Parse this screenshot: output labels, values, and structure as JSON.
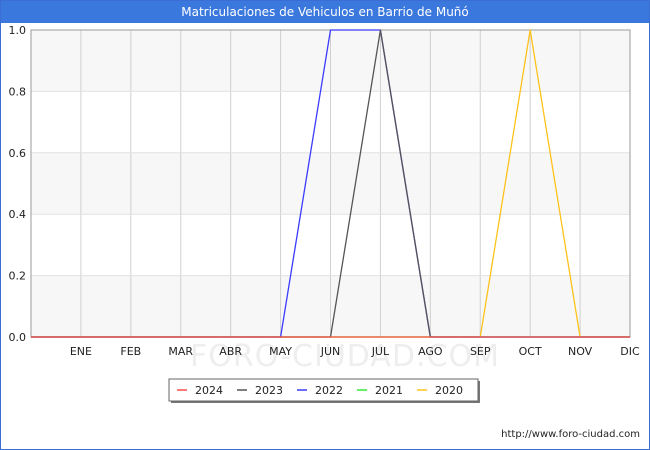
{
  "title": "Matriculaciones de Vehiculos en Barrio de Muñó",
  "watermark": "FORO-CIUDAD.COM",
  "footer_url": "http://www.foro-ciudad.com",
  "chart_data": {
    "type": "line",
    "title": "Matriculaciones de Vehiculos en Barrio de Muñó",
    "xlabel": "",
    "ylabel": "",
    "categories": [
      "",
      "ENE",
      "FEB",
      "MAR",
      "ABR",
      "MAY",
      "JUN",
      "JUL",
      "AGO",
      "SEP",
      "OCT",
      "NOV",
      "DIC"
    ],
    "ylim": [
      0,
      1
    ],
    "yticks": [
      "0.0",
      "0.2",
      "0.4",
      "0.6",
      "0.8",
      "1.0"
    ],
    "grid": true,
    "legend_position": "bottom-center",
    "series": [
      {
        "name": "2024",
        "color": "#ff4d4d",
        "values": [
          0,
          0,
          0,
          0,
          0,
          0,
          0,
          0,
          0,
          0,
          0,
          0,
          0
        ]
      },
      {
        "name": "2023",
        "color": "#555555",
        "values": [
          0,
          0,
          0,
          0,
          0,
          0,
          0,
          1,
          0,
          0,
          0,
          0,
          0
        ]
      },
      {
        "name": "2022",
        "color": "#3b3bff",
        "values": [
          0,
          0,
          0,
          0,
          0,
          0,
          1,
          1,
          0,
          0,
          0,
          0,
          0
        ]
      },
      {
        "name": "2021",
        "color": "#33ee33",
        "values": [
          0,
          0,
          0,
          0,
          0,
          0,
          0,
          0,
          0,
          0,
          0,
          0,
          0
        ]
      },
      {
        "name": "2020",
        "color": "#ffc21a",
        "values": [
          0,
          0,
          0,
          0,
          0,
          0,
          0,
          0,
          0,
          0,
          1,
          0,
          0
        ]
      }
    ]
  }
}
